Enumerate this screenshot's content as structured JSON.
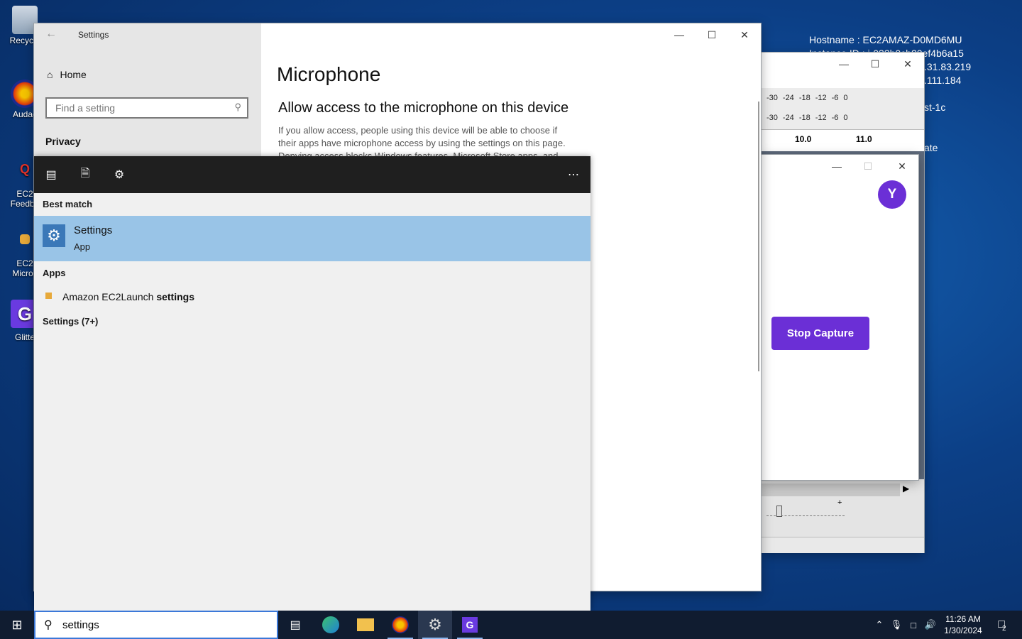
{
  "desktop": {
    "icons": [
      {
        "label": "Recycle"
      },
      {
        "label": "Audac"
      },
      {
        "label": "EC2"
      },
      {
        "label": "Feedba"
      },
      {
        "label": "EC2"
      },
      {
        "label": "Micros"
      },
      {
        "label": "Glitte"
      }
    ],
    "bginfo": [
      "Hostname : EC2AMAZ-D0MD6MU",
      "Instance ID : i-033b0cb20ef4b6a15",
      ".31.83.219",
      ".111.184",
      "st-1c",
      "ate"
    ]
  },
  "settings": {
    "title": "Settings",
    "home": "Home",
    "search_placeholder": "Find a setting",
    "section": "Privacy",
    "page_title": "Microphone",
    "subheading": "Allow access to the microphone on this device",
    "body_line1": "If you allow access, people using this device will be able to choose if",
    "body_line2": "their apps have microphone access by using the settings on this page.",
    "body_line3": "Denying access blocks Windows features, Microsoft Store apps, and"
  },
  "audio_window": {
    "meter_ticks": [
      "-30",
      "-24",
      "-18",
      "-12",
      "-6",
      "0"
    ],
    "ruler": [
      "10.0",
      "11.0"
    ],
    "slider_plus": "+"
  },
  "capture_window": {
    "avatar": "Y",
    "stop_button": "Stop Capture",
    "accent": "#6b2fd6"
  },
  "start_search": {
    "best_match_header": "Best match",
    "best_title": "Settings",
    "best_subtitle": "App",
    "apps_header": "Apps",
    "app_prefix": "Amazon EC2Launch ",
    "app_bold": "settings",
    "more_header": "Settings (7+)",
    "more_icon": "ellipsis-icon"
  },
  "taskbar": {
    "search_value": "settings",
    "time": "11:26 AM",
    "date": "1/30/2024",
    "notifications": "2"
  }
}
